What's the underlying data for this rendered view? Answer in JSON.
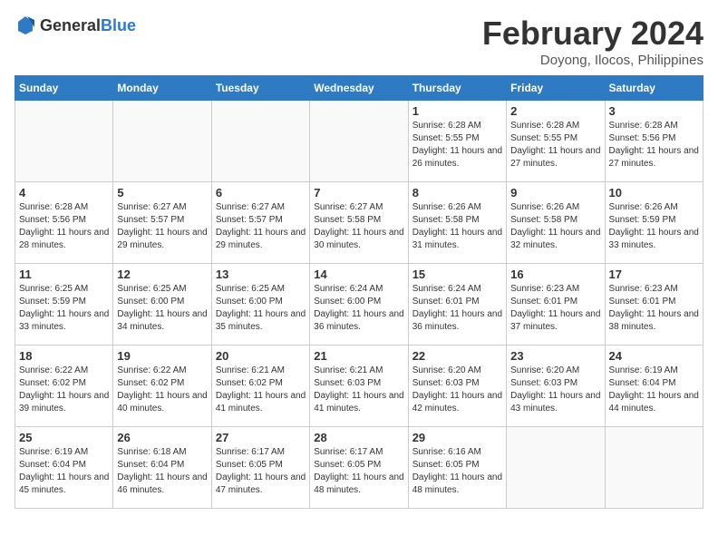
{
  "header": {
    "logo_general": "General",
    "logo_blue": "Blue",
    "title": "February 2024",
    "subtitle": "Doyong, Ilocos, Philippines"
  },
  "weekdays": [
    "Sunday",
    "Monday",
    "Tuesday",
    "Wednesday",
    "Thursday",
    "Friday",
    "Saturday"
  ],
  "weeks": [
    [
      {
        "day": "",
        "info": ""
      },
      {
        "day": "",
        "info": ""
      },
      {
        "day": "",
        "info": ""
      },
      {
        "day": "",
        "info": ""
      },
      {
        "day": "1",
        "info": "Sunrise: 6:28 AM\nSunset: 5:55 PM\nDaylight: 11 hours and 26 minutes."
      },
      {
        "day": "2",
        "info": "Sunrise: 6:28 AM\nSunset: 5:55 PM\nDaylight: 11 hours and 27 minutes."
      },
      {
        "day": "3",
        "info": "Sunrise: 6:28 AM\nSunset: 5:56 PM\nDaylight: 11 hours and 27 minutes."
      }
    ],
    [
      {
        "day": "4",
        "info": "Sunrise: 6:28 AM\nSunset: 5:56 PM\nDaylight: 11 hours and 28 minutes."
      },
      {
        "day": "5",
        "info": "Sunrise: 6:27 AM\nSunset: 5:57 PM\nDaylight: 11 hours and 29 minutes."
      },
      {
        "day": "6",
        "info": "Sunrise: 6:27 AM\nSunset: 5:57 PM\nDaylight: 11 hours and 29 minutes."
      },
      {
        "day": "7",
        "info": "Sunrise: 6:27 AM\nSunset: 5:58 PM\nDaylight: 11 hours and 30 minutes."
      },
      {
        "day": "8",
        "info": "Sunrise: 6:26 AM\nSunset: 5:58 PM\nDaylight: 11 hours and 31 minutes."
      },
      {
        "day": "9",
        "info": "Sunrise: 6:26 AM\nSunset: 5:58 PM\nDaylight: 11 hours and 32 minutes."
      },
      {
        "day": "10",
        "info": "Sunrise: 6:26 AM\nSunset: 5:59 PM\nDaylight: 11 hours and 33 minutes."
      }
    ],
    [
      {
        "day": "11",
        "info": "Sunrise: 6:25 AM\nSunset: 5:59 PM\nDaylight: 11 hours and 33 minutes."
      },
      {
        "day": "12",
        "info": "Sunrise: 6:25 AM\nSunset: 6:00 PM\nDaylight: 11 hours and 34 minutes."
      },
      {
        "day": "13",
        "info": "Sunrise: 6:25 AM\nSunset: 6:00 PM\nDaylight: 11 hours and 35 minutes."
      },
      {
        "day": "14",
        "info": "Sunrise: 6:24 AM\nSunset: 6:00 PM\nDaylight: 11 hours and 36 minutes."
      },
      {
        "day": "15",
        "info": "Sunrise: 6:24 AM\nSunset: 6:01 PM\nDaylight: 11 hours and 36 minutes."
      },
      {
        "day": "16",
        "info": "Sunrise: 6:23 AM\nSunset: 6:01 PM\nDaylight: 11 hours and 37 minutes."
      },
      {
        "day": "17",
        "info": "Sunrise: 6:23 AM\nSunset: 6:01 PM\nDaylight: 11 hours and 38 minutes."
      }
    ],
    [
      {
        "day": "18",
        "info": "Sunrise: 6:22 AM\nSunset: 6:02 PM\nDaylight: 11 hours and 39 minutes."
      },
      {
        "day": "19",
        "info": "Sunrise: 6:22 AM\nSunset: 6:02 PM\nDaylight: 11 hours and 40 minutes."
      },
      {
        "day": "20",
        "info": "Sunrise: 6:21 AM\nSunset: 6:02 PM\nDaylight: 11 hours and 41 minutes."
      },
      {
        "day": "21",
        "info": "Sunrise: 6:21 AM\nSunset: 6:03 PM\nDaylight: 11 hours and 41 minutes."
      },
      {
        "day": "22",
        "info": "Sunrise: 6:20 AM\nSunset: 6:03 PM\nDaylight: 11 hours and 42 minutes."
      },
      {
        "day": "23",
        "info": "Sunrise: 6:20 AM\nSunset: 6:03 PM\nDaylight: 11 hours and 43 minutes."
      },
      {
        "day": "24",
        "info": "Sunrise: 6:19 AM\nSunset: 6:04 PM\nDaylight: 11 hours and 44 minutes."
      }
    ],
    [
      {
        "day": "25",
        "info": "Sunrise: 6:19 AM\nSunset: 6:04 PM\nDaylight: 11 hours and 45 minutes."
      },
      {
        "day": "26",
        "info": "Sunrise: 6:18 AM\nSunset: 6:04 PM\nDaylight: 11 hours and 46 minutes."
      },
      {
        "day": "27",
        "info": "Sunrise: 6:17 AM\nSunset: 6:05 PM\nDaylight: 11 hours and 47 minutes."
      },
      {
        "day": "28",
        "info": "Sunrise: 6:17 AM\nSunset: 6:05 PM\nDaylight: 11 hours and 48 minutes."
      },
      {
        "day": "29",
        "info": "Sunrise: 6:16 AM\nSunset: 6:05 PM\nDaylight: 11 hours and 48 minutes."
      },
      {
        "day": "",
        "info": ""
      },
      {
        "day": "",
        "info": ""
      }
    ]
  ]
}
